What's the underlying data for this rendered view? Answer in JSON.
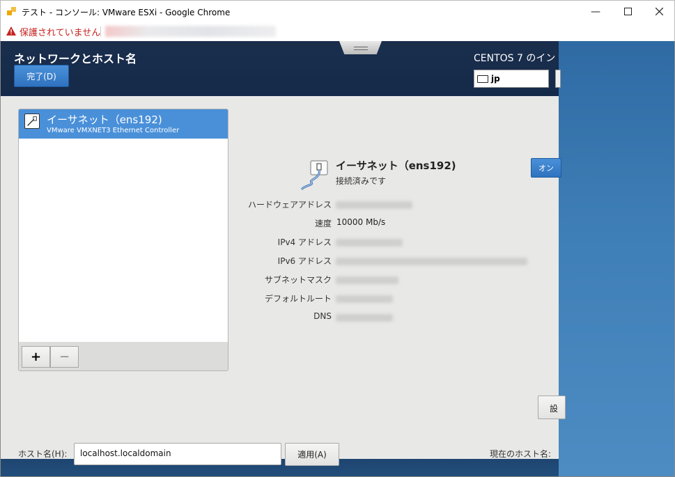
{
  "window": {
    "title": "テスト - コンソール: VMware ESXi - Google Chrome",
    "minimize_icon": "minimize-icon",
    "maximize_icon": "maximize-icon",
    "close_icon": "close-icon"
  },
  "addressbar": {
    "security_text": "保護されていません",
    "url": ""
  },
  "header": {
    "title": "ネットワークとホスト名",
    "done_label": "完了(D)",
    "os_title": "CENTOS 7 のイン",
    "keyboard_layout": "jp"
  },
  "device_list": {
    "items": [
      {
        "name": "イーサネット（ens192)",
        "description": "VMware VMXNET3 Ethernet Controller"
      }
    ],
    "add_label": "+",
    "remove_label": "−"
  },
  "details": {
    "title": "イーサネット（ens192)",
    "status": "接続済みです",
    "toggle_label": "オン",
    "rows": [
      {
        "label": "ハードウェアアドレス",
        "value": ""
      },
      {
        "label": "速度",
        "value": "10000 Mb/s"
      },
      {
        "label": "IPv4 アドレス",
        "value": ""
      },
      {
        "label": "IPv6 アドレス",
        "value": ""
      },
      {
        "label": "サブネットマスク",
        "value": ""
      },
      {
        "label": "デフォルトルート",
        "value": ""
      },
      {
        "label": "DNS",
        "value": ""
      }
    ],
    "settings_label": "設"
  },
  "hostname": {
    "label": "ホスト名(H):",
    "value": "localhost.localdomain",
    "apply_label": "適用(A)",
    "current_label": "現在のホスト名:"
  },
  "colors": {
    "accent": "#4a90d9",
    "warning": "#c5221f",
    "header_bg": "#15294a",
    "pane_bg": "#e8e8e7"
  }
}
